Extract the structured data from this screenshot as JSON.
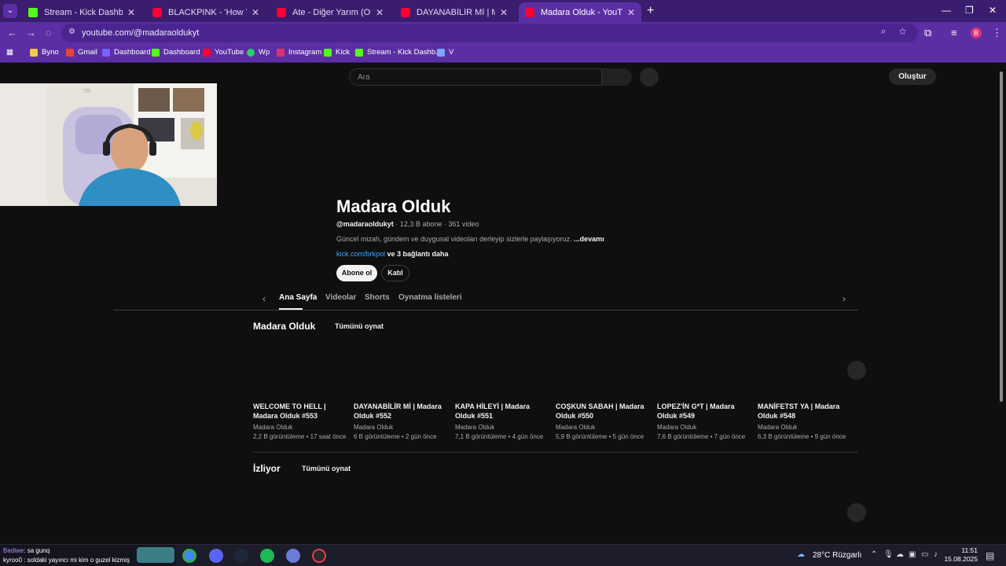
{
  "browser": {
    "tabs": [
      {
        "title": "Stream - Kick Dashboard",
        "icon": "kick-icon"
      },
      {
        "title": "BLACKPINK - 'How You Like That'",
        "icon": "youtube-icon"
      },
      {
        "title": "Ate - Diğer Yarım (Official Video)",
        "icon": "youtube-icon"
      },
      {
        "title": "DAYANABİLİR Mİ | Madara Olduk",
        "icon": "youtube-icon"
      },
      {
        "title": "Madara Olduk - YouTube",
        "icon": "youtube-icon",
        "active": true
      }
    ],
    "url": "youtube.com/@madaraoldukyt",
    "profile_initial": "B",
    "bookmarks": [
      {
        "label": "Byno",
        "color": "#f2c94c"
      },
      {
        "label": "Gmail",
        "color": "#ea4335"
      },
      {
        "label": "Dashboard",
        "color": "#7b61ff"
      },
      {
        "label": "Dashboard",
        "color": "#53fc18"
      },
      {
        "label": "YouTube",
        "color": "#ff0033"
      },
      {
        "label": "Wp",
        "color": "#25d366"
      },
      {
        "label": "Instagram",
        "color": "#e1306c"
      },
      {
        "label": "Kick",
        "color": "#53fc18"
      },
      {
        "label": "Stream - Kick Dashb...",
        "color": "#53fc18"
      },
      {
        "label": "V",
        "color": "#7aa7ff"
      }
    ]
  },
  "youtube": {
    "search_placeholder": "Ara",
    "create_label": "Oluştur",
    "webcam_badge": "TR",
    "channel": {
      "name": "Madara Olduk",
      "handle": "@madaraoldukyt",
      "stats": "· 12,3 B abone · 361 video",
      "description": "Güncel mizah, gündem ve duygusal videoları derleyip sizlerle paylaşıyoruz.",
      "more": "...devamı",
      "link": "kick.com/brkpol",
      "link_more": "ve 3 bağlantı daha",
      "subscribe": "Abone ol",
      "join": "Katıl"
    },
    "channel_tabs": [
      "Ana Sayfa",
      "Videolar",
      "Shorts",
      "Oynatma listeleri"
    ],
    "sections": [
      {
        "title": "Madara Olduk",
        "play_all": "Tümünü oynat"
      },
      {
        "title": "İzliyor",
        "play_all": "Tümünü oynat"
      }
    ],
    "videos": [
      {
        "title": "WELCOME TO HELL | Madara Olduk #553",
        "channel": "Madara Olduk",
        "meta": "2,2 B görüntüleme • 17 saat önce"
      },
      {
        "title": "DAYANABİLİR Mİ | Madara Olduk #552",
        "channel": "Madara Olduk",
        "meta": "6 B görüntüleme • 2 gün önce"
      },
      {
        "title": "KAPA HİLEYİ | Madara Olduk #551",
        "channel": "Madara Olduk",
        "meta": "7,1 B görüntüleme • 4 gün önce"
      },
      {
        "title": "COŞKUN SABAH | Madara Olduk #550",
        "channel": "Madara Olduk",
        "meta": "5,9 B görüntüleme • 5 gün önce"
      },
      {
        "title": "LOPEZ'İN G*T | Madara Olduk #549",
        "channel": "Madara Olduk",
        "meta": "7,6 B görüntüleme • 7 gün önce"
      },
      {
        "title": "MANİFETST YA | Madara Olduk #548",
        "channel": "Madara Olduk",
        "meta": "6,3 B görüntüleme • 9 gün önce"
      }
    ]
  },
  "taskbar": {
    "chat_user": "Bediwe",
    "chat_msg": ": sa gunq",
    "chat_line2": "kyroo0 : soldaki yayıncı mi kim o guzel kizmiş",
    "weather": "28°C  Rüzgarlı",
    "time": "11:51",
    "date": "15.08.2025"
  }
}
